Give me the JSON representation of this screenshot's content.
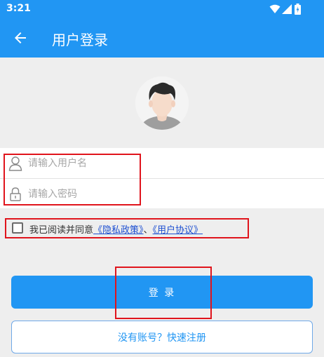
{
  "status_bar": {
    "time": "3:21",
    "icons": [
      "wifi-icon",
      "signal-icon",
      "battery-icon"
    ]
  },
  "app_bar": {
    "back_icon": "back-arrow-icon",
    "title": "用户登录"
  },
  "avatar": {
    "icon": "avatar-icon"
  },
  "form": {
    "username": {
      "icon": "user-icon",
      "placeholder": "请输入用户名",
      "value": ""
    },
    "password": {
      "icon": "lock-icon",
      "placeholder": "请输入密码",
      "value": ""
    }
  },
  "agreement": {
    "checked": false,
    "prefix": "我已阅读并同意",
    "privacy_link": "《隐私政策》",
    "separator": "、",
    "terms_link": "《用户协议》"
  },
  "buttons": {
    "login_label": "登 录",
    "register_label": "没有账号？快速注册"
  },
  "colors": {
    "primary": "#2196f3",
    "link": "#1c4fd1",
    "highlight": "#e0141c",
    "background": "#eeeeee"
  }
}
